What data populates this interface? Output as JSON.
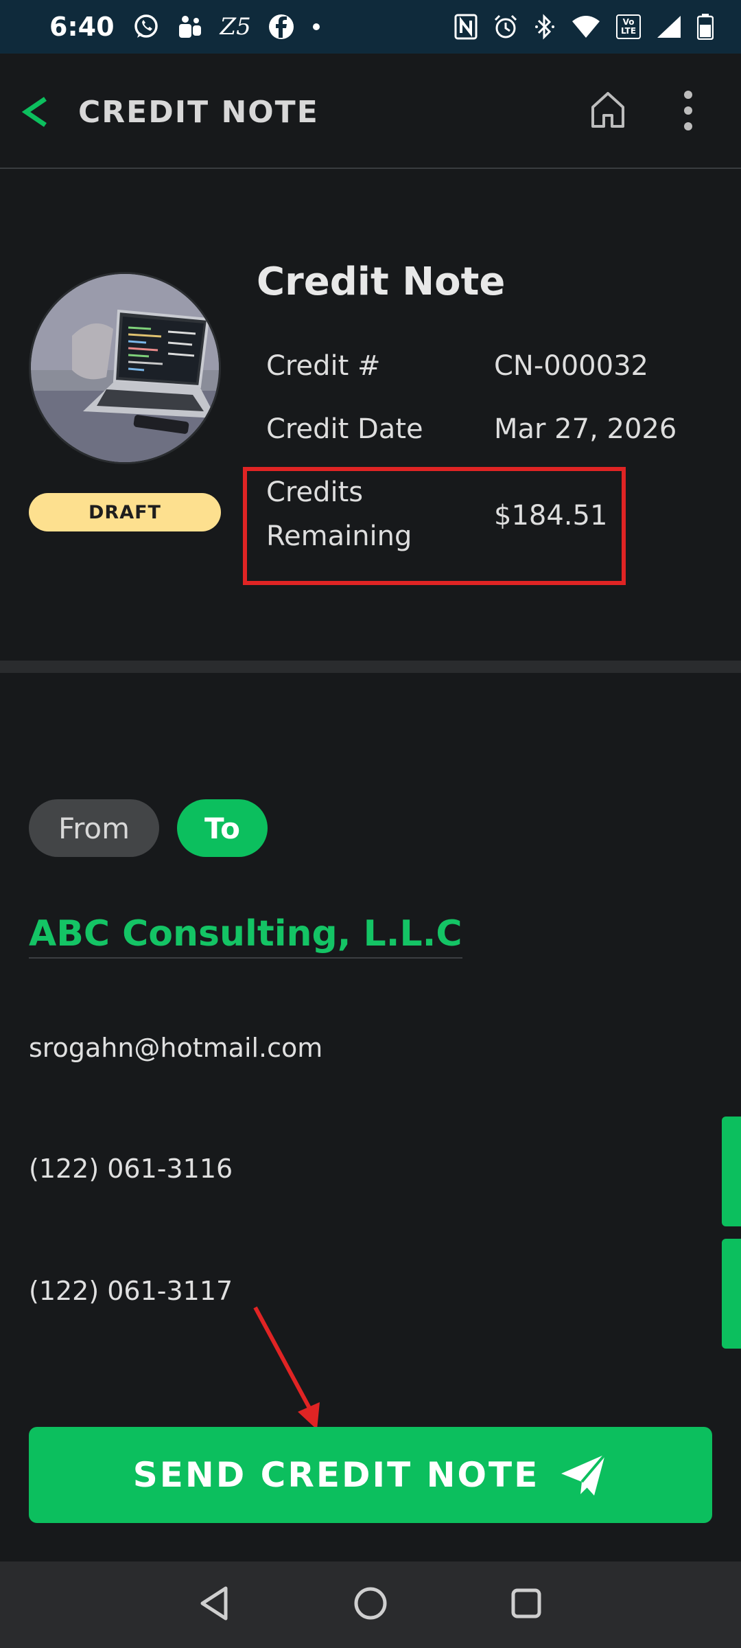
{
  "status_bar": {
    "time": "6:40",
    "left_icons": [
      "whatsapp-icon",
      "teams-icon",
      "zee5-icon",
      "facebook-icon",
      "dot-icon"
    ],
    "right_icons": [
      "nfc-icon",
      "alarm-icon",
      "bluetooth-icon",
      "wifi-icon",
      "volte-icon",
      "signal-icon",
      "battery-icon"
    ],
    "zee5_text": "Z5",
    "volte_text": "Vo LTE"
  },
  "app_bar": {
    "title": "CREDIT NOTE",
    "back_icon": "chevron-left-icon",
    "home_icon": "home-icon",
    "more_icon": "more-vertical-icon"
  },
  "header": {
    "doc_title": "Credit Note",
    "status_badge": "DRAFT",
    "credit_number_label": "Credit #",
    "credit_number_value": "CN-000032",
    "credit_date_label": "Credit Date",
    "credit_date_value": "Mar 27, 2026",
    "credits_remaining_label_line1": "Credits",
    "credits_remaining_label_line2": "Remaining",
    "credits_remaining_value": "$184.51"
  },
  "party_toggle": {
    "from_label": "From",
    "to_label": "To",
    "selected": "To"
  },
  "client": {
    "name": "ABC Consulting, L.L.C",
    "email": "srogahn@hotmail.com",
    "phone_1": "(122) 061-3116",
    "phone_2": "(122) 061-3117"
  },
  "actions": {
    "send_label": "SEND CREDIT NOTE",
    "send_icon": "send-icon"
  },
  "nav_bar": {
    "icons": [
      "back-triangle-icon",
      "home-circle-icon",
      "recents-square-icon"
    ]
  },
  "colors": {
    "accent_green": "#0cbf5e",
    "draft_yellow": "#fde08f",
    "annotation_red": "#e02424",
    "status_bar_bg": "#0f2a3b"
  }
}
